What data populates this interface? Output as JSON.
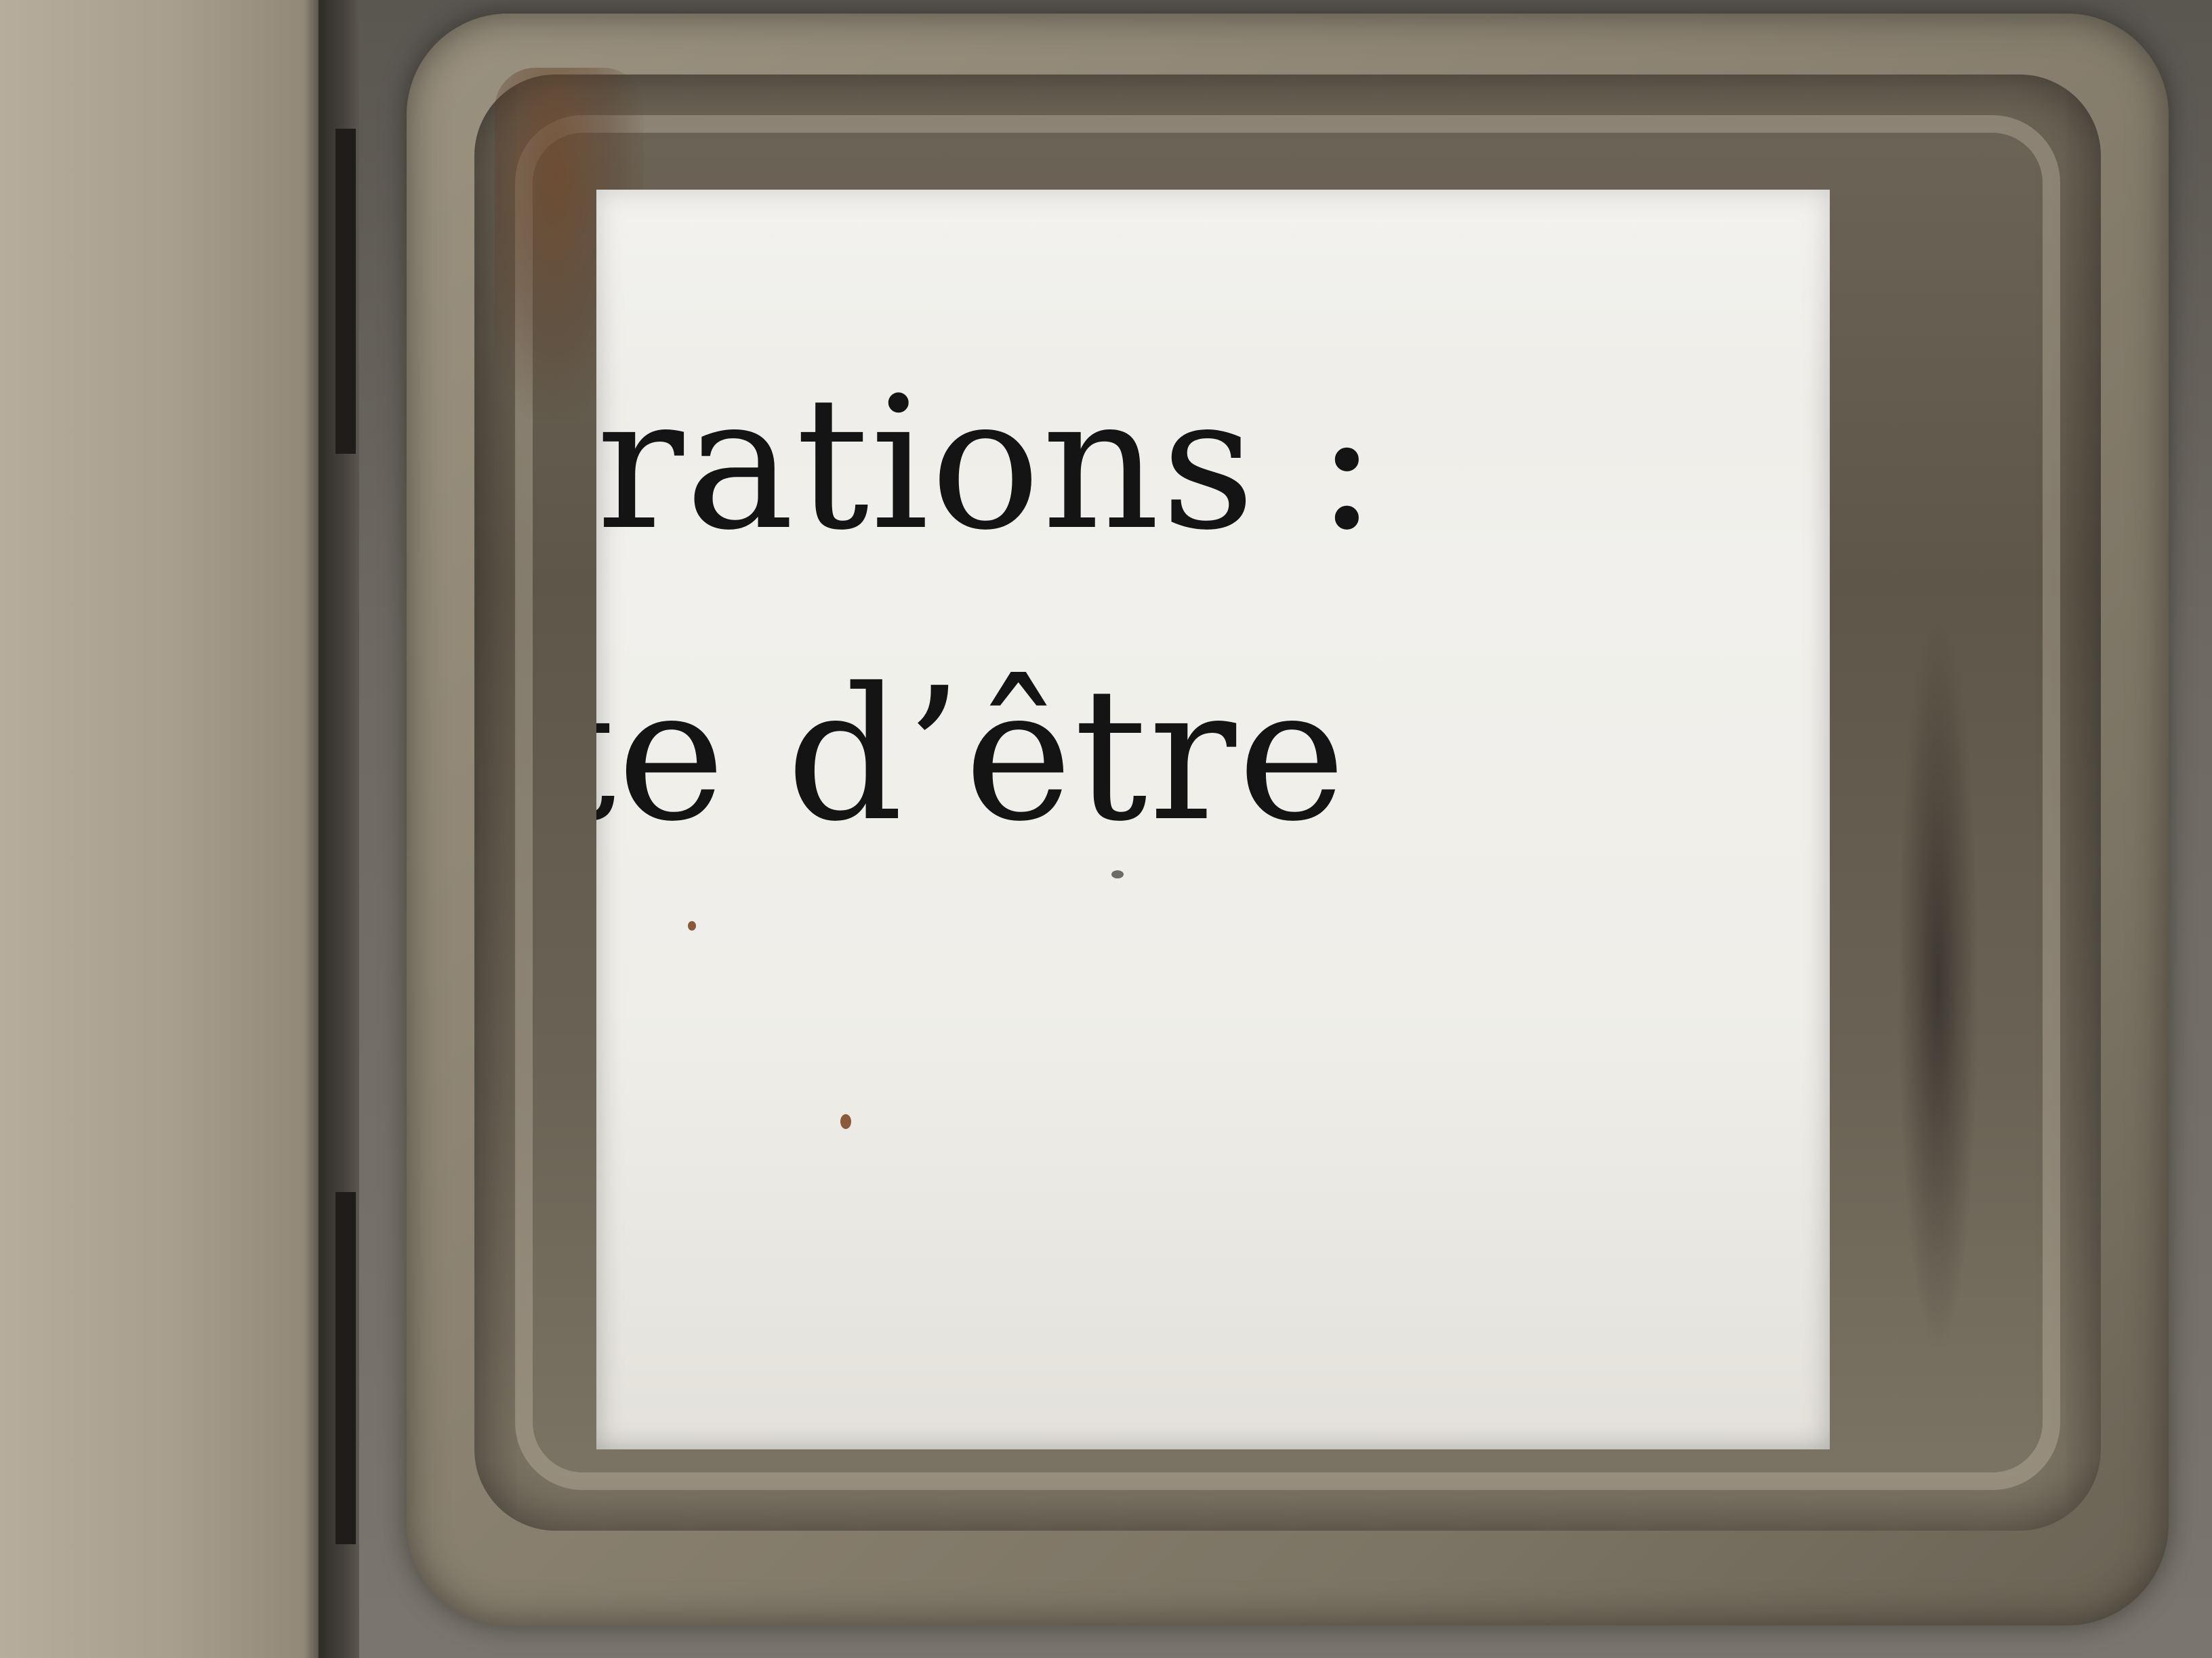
{
  "photo": {
    "subject": "magnifying loupe over printed page",
    "lines": [
      "rations :",
      "te d’être"
    ]
  }
}
